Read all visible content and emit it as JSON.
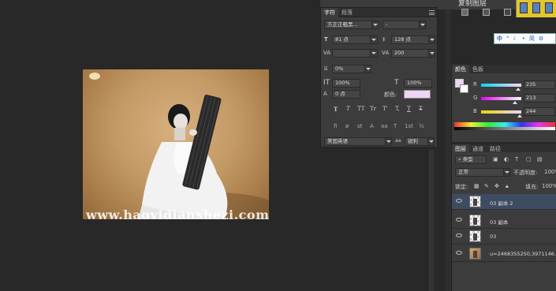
{
  "canvas": {
    "watermark": "www.haoyidianshezi.com"
  },
  "top_bar": {
    "copy_layer_label": "复制图层"
  },
  "character_panel": {
    "tabs": [
      "字符",
      "段落"
    ],
    "font_family": "方正正粗黑...",
    "font_style": "-",
    "font_size": "81 点",
    "leading": "128 点",
    "kerning": "",
    "tracking": "200",
    "tsume": "0%",
    "vertical_scale": "100%",
    "horizontal_scale": "100%",
    "baseline_shift": "0 点",
    "color_label": "颜色:",
    "text_color": "#eed5f4",
    "style_buttons": [
      "T",
      "T",
      "TT",
      "Tr",
      "T'",
      "T,",
      "T",
      "T"
    ],
    "opentype_buttons": [
      "fi",
      "ø",
      "st",
      "A",
      "aa",
      "T",
      "1st",
      "½"
    ],
    "language": "美国英语",
    "aa_label": "aa",
    "antialias": "锐利"
  },
  "ime": {
    "items": [
      "中",
      "°",
      "☾",
      "•",
      "简",
      "⚙"
    ]
  },
  "color_panel": {
    "tabs": [
      "颜色",
      "色板"
    ],
    "foreground": "#ebd5f4",
    "background": "#ffffff",
    "channels": [
      {
        "name": "R",
        "value": "235",
        "level": 0.92
      },
      {
        "name": "G",
        "value": "213",
        "level": 0.84
      },
      {
        "name": "B",
        "value": "244",
        "level": 0.96
      }
    ]
  },
  "layers_panel": {
    "tabs": [
      "图层",
      "通道",
      "路径"
    ],
    "filter_kind": "类型",
    "blend_mode": "正常",
    "opacity_label": "不透明度:",
    "opacity_value": "100%",
    "lock_label": "锁定:",
    "fill_label": "填充:",
    "fill_value": "100%",
    "layers": [
      {
        "name": "03 副本 2",
        "selected": true,
        "thumb": "transparent"
      },
      {
        "name": "03 副本",
        "selected": false,
        "thumb": "transparent"
      },
      {
        "name": "03",
        "selected": false,
        "thumb": "transparent"
      },
      {
        "name": "u=2468355250,3971146...",
        "selected": false,
        "thumb": "photo"
      }
    ]
  }
}
